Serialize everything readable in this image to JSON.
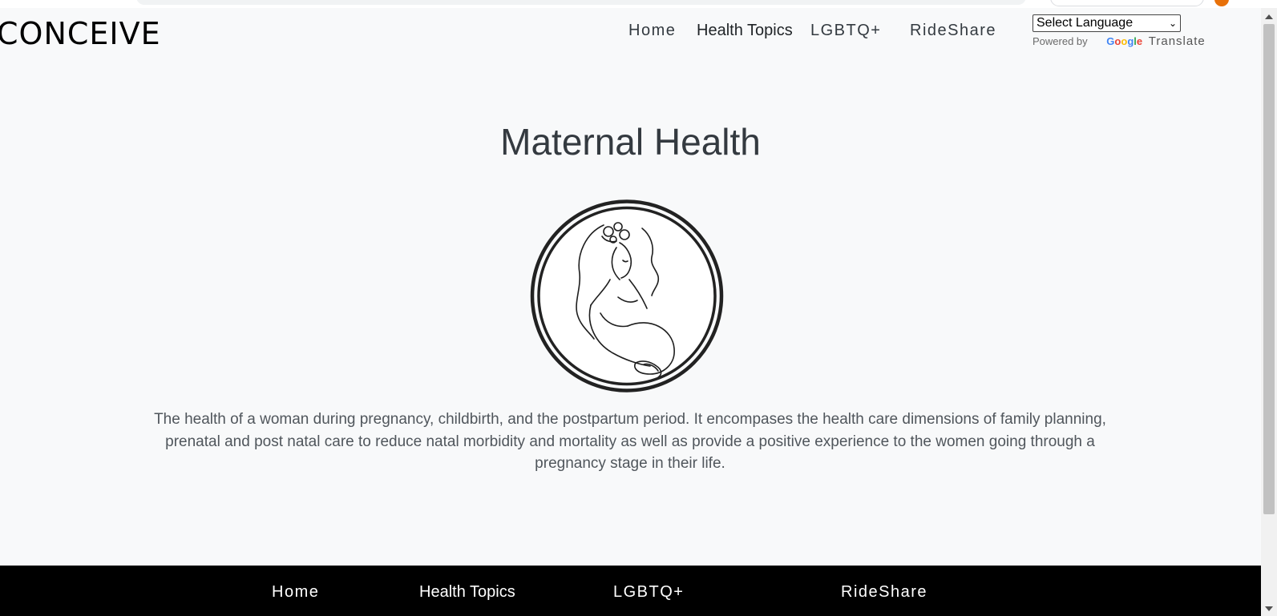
{
  "site": {
    "logo": "CONCEIVE"
  },
  "nav": {
    "home": "Home",
    "health_topics": "Health Topics",
    "lgbtq": "LGBTQ+",
    "rideshare": "RideShare"
  },
  "translate": {
    "select_value": "Select Language",
    "powered_by": "Powered by",
    "google": "Google",
    "translate_label": "Translate"
  },
  "main": {
    "title": "Maternal Health",
    "description": "The health of a woman during pregnancy, childbirth, and the postpartum period. It encompases the health care dimensions of family planning, prenatal and post natal care to reduce natal morbidity and mortality as well as provide a positive experience to the women going through a pregnancy stage in their life."
  },
  "footer": {
    "home": "Home",
    "health_topics": "Health Topics",
    "lgbtq": "LGBTQ+",
    "rideshare": "RideShare"
  },
  "icons": {
    "emblem": "pregnant-woman-emblem-icon",
    "select_chevron": "chevron-down-icon",
    "scroll_up": "arrow-up-icon",
    "scroll_down": "arrow-down-icon"
  },
  "colors": {
    "page_background": "#f8f9fa",
    "footer_background": "#000000",
    "title_text": "#343a40",
    "body_text": "#50565c",
    "footer_text": "#ffffff"
  }
}
